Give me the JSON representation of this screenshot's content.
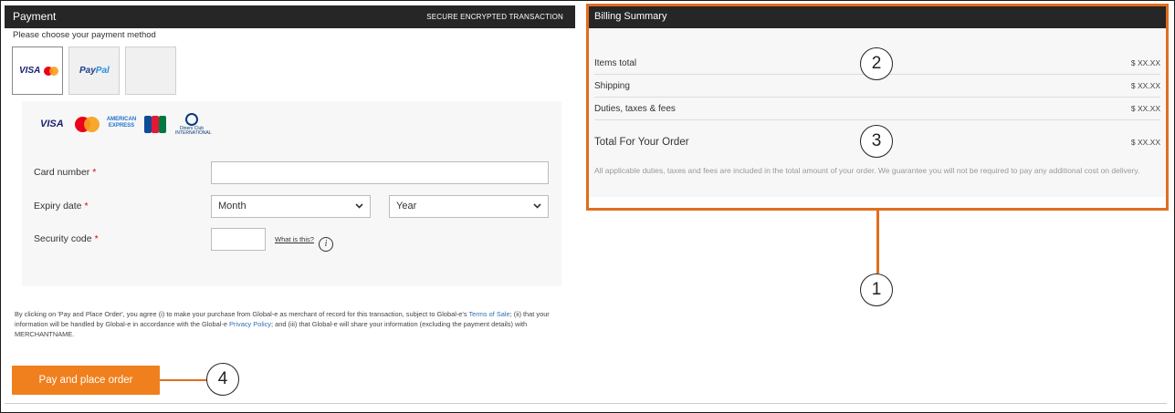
{
  "payment": {
    "title": "Payment",
    "secure_label": "SECURE ENCRYPTED TRANSACTION",
    "choose_label": "Please choose your payment method",
    "methods": [
      {
        "name": "visa-mastercard",
        "label": "VISA"
      },
      {
        "name": "paypal",
        "label_a": "Pay",
        "label_b": "Pal"
      },
      {
        "name": "empty",
        "label": ""
      }
    ],
    "card_logos": [
      "VISA",
      "Mastercard",
      "AMERICAN EXPRESS",
      "JCB",
      "Diners Club INTERNATIONAL"
    ],
    "amex_text": "AMERICAN EXPRESS",
    "diners_text": "Diners Club INTERNATIONAL",
    "fields": {
      "card_number_label": "Card number",
      "expiry_label": "Expiry date",
      "month_value": "Month",
      "year_value": "Year",
      "security_label": "Security code",
      "what_is_this": "What is this?",
      "required_mark": "*"
    },
    "legal": {
      "part1": "By clicking on 'Pay and Place Order', you agree (i) to make your purchase from Global-e as merchant of record for this transaction, subject to Global-e's ",
      "terms_link": "Terms of Sale",
      "part2": "; (ii) that your information will be handled by Global-e in accordance with the Global-e ",
      "privacy_link": "Privacy Policy",
      "part3": "; and (iii) that Global-e will share your information (excluding the payment details) with MERCHANTNAME."
    },
    "pay_button": "Pay and place order"
  },
  "billing": {
    "title": "Billing Summary",
    "rows": [
      {
        "label": "Items total",
        "value": "$ XX.XX"
      },
      {
        "label": "Shipping",
        "value": "$ XX.XX"
      },
      {
        "label": "Duties, taxes & fees",
        "value": "$ XX.XX"
      }
    ],
    "total_label": "Total For Your Order",
    "total_value": "$ XX.XX",
    "note": "All applicable duties, taxes and fees are included in the total amount of your order. We guarantee you will not be required to pay any additional cost on delivery."
  },
  "callouts": [
    "1",
    "2",
    "3",
    "4"
  ],
  "colors": {
    "accent": "#f07f1d",
    "outline": "#e06e1e",
    "header_bg": "#262626",
    "link": "#2e6fb5",
    "required": "#e00000"
  }
}
